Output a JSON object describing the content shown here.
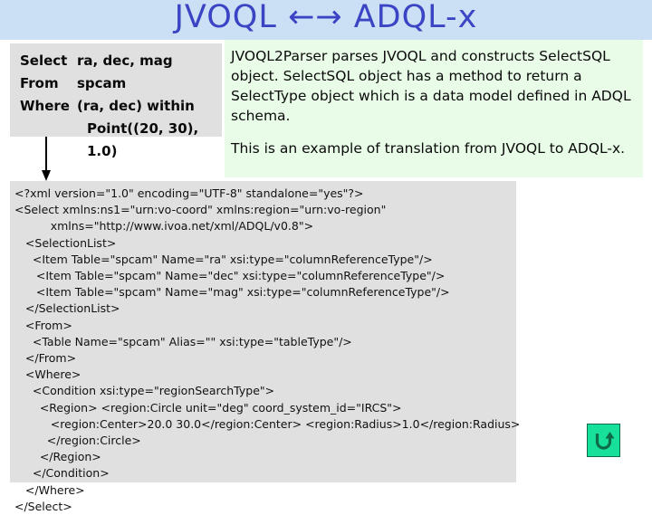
{
  "slide": {
    "title": "JVOQL ←→ ADQL-x",
    "title_bg_color": "#cce0f5",
    "title_text_color": "#3b44c4"
  },
  "query_panel": {
    "bg_color": "#e0e0e0",
    "rows": [
      {
        "keyword": "Select",
        "value": "ra, dec, mag"
      },
      {
        "keyword": "From",
        "value": "spcam"
      },
      {
        "keyword": "Where",
        "value": "(ra, dec) within"
      }
    ],
    "continuation": "Point((20, 30), 1.0)"
  },
  "connector": {
    "icon": "down-arrow-icon"
  },
  "description_panel": {
    "bg_color": "#e8fce8",
    "paragraph_1": "JVOQL2Parser parses JVOQL and constructs SelectSQL object. SelectSQL object has a method to return a SelectType object which is a data model defined in ADQL schema.",
    "paragraph_2": "This is an example of translation from JVOQL to ADQL-x."
  },
  "xml_panel": {
    "bg_color": "#e0e0e0",
    "code": "<?xml version=\"1.0\" encoding=\"UTF-8\" standalone=\"yes\"?>\n<Select xmlns:ns1=\"urn:vo-coord\" xmlns:region=\"urn:vo-region\"\n          xmlns=\"http://www.ivoa.net/xml/ADQL/v0.8\">\n   <SelectionList>\n     <Item Table=\"spcam\" Name=\"ra\" xsi:type=\"columnReferenceType\"/>\n      <Item Table=\"spcam\" Name=\"dec\" xsi:type=\"columnReferenceType\"/>\n      <Item Table=\"spcam\" Name=\"mag\" xsi:type=\"columnReferenceType\"/>\n   </SelectionList>\n   <From>\n     <Table Name=\"spcam\" Alias=\"\" xsi:type=\"tableType\"/>\n   </From>\n   <Where>\n     <Condition xsi:type=\"regionSearchType\">\n       <Region> <region:Circle unit=\"deg\" coord_system_id=\"IRCS\">\n          <region:Center>20.0 30.0</region:Center> <region:Radius>1.0</region:Radius>\n         </region:Circle>\n       </Region>\n     </Condition>\n   </Where>\n</Select>"
  },
  "return_button": {
    "icon": "u-turn-arrow-icon",
    "bg_color": "#17e09a",
    "icon_color": "#0d6b4a"
  }
}
